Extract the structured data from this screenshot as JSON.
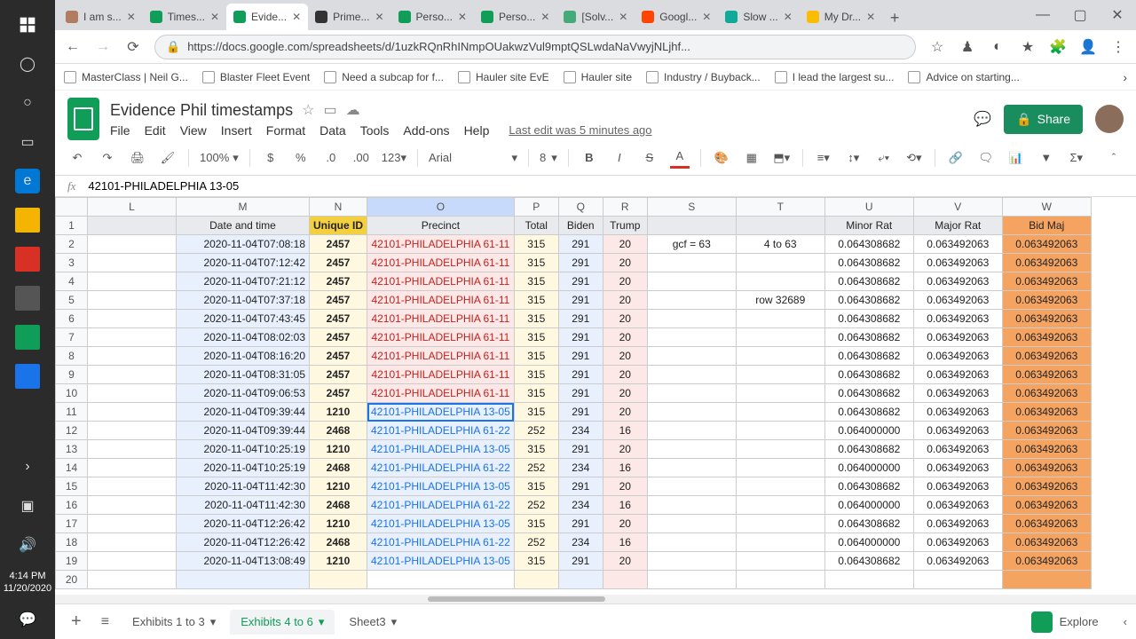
{
  "clock": {
    "time": "4:14 PM",
    "date": "11/20/2020"
  },
  "browser_tabs": [
    {
      "label": "I am s...",
      "color": "#b07d62"
    },
    {
      "label": "Times...",
      "color": "#0f9d58"
    },
    {
      "label": "Evide...",
      "color": "#0f9d58",
      "active": true
    },
    {
      "label": "Prime...",
      "color": "#333"
    },
    {
      "label": "Perso...",
      "color": "#0f9d58"
    },
    {
      "label": "Perso...",
      "color": "#0f9d58"
    },
    {
      "label": "[Solv...",
      "color": "#4a7"
    },
    {
      "label": "Googl...",
      "color": "#ff4500"
    },
    {
      "label": "Slow ...",
      "color": "#1a9"
    },
    {
      "label": "My Dr...",
      "color": "#fbbc04"
    }
  ],
  "url": "https://docs.google.com/spreadsheets/d/1uzkRQnRhINmpOUakwzVul9mptQSLwdaNaVwyjNLjhf...",
  "bookmarks": [
    "MasterClass | Neil G...",
    "Blaster Fleet Event",
    "Need a subcap for f...",
    "Hauler site EvE",
    "Hauler site",
    "Industry / Buyback...",
    "I lead the largest su...",
    "Advice on starting..."
  ],
  "doc_title": "Evidence Phil timestamps",
  "menus": [
    "File",
    "Edit",
    "View",
    "Insert",
    "Format",
    "Data",
    "Tools",
    "Add-ons",
    "Help"
  ],
  "last_edit": "Last edit was 5 minutes ago",
  "share": "Share",
  "toolbar": {
    "zoom": "100%",
    "font": "Arial",
    "fontsize": "8",
    "numfmt": "123"
  },
  "fx_value": "42101-PHILADELPHIA 13-05",
  "cols": [
    "L",
    "M",
    "N",
    "O",
    "P",
    "Q",
    "R",
    "S",
    "T",
    "U",
    "V",
    "W"
  ],
  "headers": {
    "M": "Date and time",
    "N": "Unique ID",
    "O": "Precinct",
    "P": "Total",
    "Q": "Biden",
    "R": "Trump",
    "U": "Minor Rat",
    "V": "Major Rat",
    "W": "Bid Maj"
  },
  "annot": {
    "s": "gcf = 63",
    "t": "4 to 63",
    "t4": "row 32689"
  },
  "rows": [
    {
      "r": 2,
      "m": "2020-11-04T07:08:18",
      "n": "2457",
      "o": "42101-PHILADELPHIA 61-11",
      "oc": "red",
      "p": "315",
      "q": "291",
      "rr": "20",
      "u": "0.064308682",
      "v": "0.063492063",
      "w": "0.063492063"
    },
    {
      "r": 3,
      "m": "2020-11-04T07:12:42",
      "n": "2457",
      "o": "42101-PHILADELPHIA 61-11",
      "oc": "red",
      "p": "315",
      "q": "291",
      "rr": "20",
      "u": "0.064308682",
      "v": "0.063492063",
      "w": "0.063492063"
    },
    {
      "r": 4,
      "m": "2020-11-04T07:21:12",
      "n": "2457",
      "o": "42101-PHILADELPHIA 61-11",
      "oc": "red",
      "p": "315",
      "q": "291",
      "rr": "20",
      "u": "0.064308682",
      "v": "0.063492063",
      "w": "0.063492063"
    },
    {
      "r": 5,
      "m": "2020-11-04T07:37:18",
      "n": "2457",
      "o": "42101-PHILADELPHIA 61-11",
      "oc": "red",
      "p": "315",
      "q": "291",
      "rr": "20",
      "u": "0.064308682",
      "v": "0.063492063",
      "w": "0.063492063"
    },
    {
      "r": 6,
      "m": "2020-11-04T07:43:45",
      "n": "2457",
      "o": "42101-PHILADELPHIA 61-11",
      "oc": "red",
      "p": "315",
      "q": "291",
      "rr": "20",
      "u": "0.064308682",
      "v": "0.063492063",
      "w": "0.063492063"
    },
    {
      "r": 7,
      "m": "2020-11-04T08:02:03",
      "n": "2457",
      "o": "42101-PHILADELPHIA 61-11",
      "oc": "red",
      "p": "315",
      "q": "291",
      "rr": "20",
      "u": "0.064308682",
      "v": "0.063492063",
      "w": "0.063492063"
    },
    {
      "r": 8,
      "m": "2020-11-04T08:16:20",
      "n": "2457",
      "o": "42101-PHILADELPHIA 61-11",
      "oc": "red",
      "p": "315",
      "q": "291",
      "rr": "20",
      "u": "0.064308682",
      "v": "0.063492063",
      "w": "0.063492063"
    },
    {
      "r": 9,
      "m": "2020-11-04T08:31:05",
      "n": "2457",
      "o": "42101-PHILADELPHIA 61-11",
      "oc": "red",
      "p": "315",
      "q": "291",
      "rr": "20",
      "u": "0.064308682",
      "v": "0.063492063",
      "w": "0.063492063"
    },
    {
      "r": 10,
      "m": "2020-11-04T09:06:53",
      "n": "2457",
      "o": "42101-PHILADELPHIA 61-11",
      "oc": "red",
      "p": "315",
      "q": "291",
      "rr": "20",
      "u": "0.064308682",
      "v": "0.063492063",
      "w": "0.063492063"
    },
    {
      "r": 11,
      "m": "2020-11-04T09:39:44",
      "n": "1210",
      "o": "42101-PHILADELPHIA 13-05",
      "oc": "blue",
      "p": "315",
      "q": "291",
      "rr": "20",
      "u": "0.064308682",
      "v": "0.063492063",
      "w": "0.063492063",
      "sel": true
    },
    {
      "r": 12,
      "m": "2020-11-04T09:39:44",
      "n": "2468",
      "o": "42101-PHILADELPHIA 61-22",
      "oc": "blue",
      "p": "252",
      "q": "234",
      "rr": "16",
      "u": "0.064000000",
      "v": "0.063492063",
      "w": "0.063492063"
    },
    {
      "r": 13,
      "m": "2020-11-04T10:25:19",
      "n": "1210",
      "o": "42101-PHILADELPHIA 13-05",
      "oc": "blue",
      "p": "315",
      "q": "291",
      "rr": "20",
      "u": "0.064308682",
      "v": "0.063492063",
      "w": "0.063492063"
    },
    {
      "r": 14,
      "m": "2020-11-04T10:25:19",
      "n": "2468",
      "o": "42101-PHILADELPHIA 61-22",
      "oc": "blue",
      "p": "252",
      "q": "234",
      "rr": "16",
      "u": "0.064000000",
      "v": "0.063492063",
      "w": "0.063492063"
    },
    {
      "r": 15,
      "m": "2020-11-04T11:42:30",
      "n": "1210",
      "o": "42101-PHILADELPHIA 13-05",
      "oc": "blue",
      "p": "315",
      "q": "291",
      "rr": "20",
      "u": "0.064308682",
      "v": "0.063492063",
      "w": "0.063492063"
    },
    {
      "r": 16,
      "m": "2020-11-04T11:42:30",
      "n": "2468",
      "o": "42101-PHILADELPHIA 61-22",
      "oc": "blue",
      "p": "252",
      "q": "234",
      "rr": "16",
      "u": "0.064000000",
      "v": "0.063492063",
      "w": "0.063492063"
    },
    {
      "r": 17,
      "m": "2020-11-04T12:26:42",
      "n": "1210",
      "o": "42101-PHILADELPHIA 13-05",
      "oc": "blue",
      "p": "315",
      "q": "291",
      "rr": "20",
      "u": "0.064308682",
      "v": "0.063492063",
      "w": "0.063492063"
    },
    {
      "r": 18,
      "m": "2020-11-04T12:26:42",
      "n": "2468",
      "o": "42101-PHILADELPHIA 61-22",
      "oc": "blue",
      "p": "252",
      "q": "234",
      "rr": "16",
      "u": "0.064000000",
      "v": "0.063492063",
      "w": "0.063492063"
    },
    {
      "r": 19,
      "m": "2020-11-04T13:08:49",
      "n": "1210",
      "o": "42101-PHILADELPHIA 13-05",
      "oc": "blue",
      "p": "315",
      "q": "291",
      "rr": "20",
      "u": "0.064308682",
      "v": "0.063492063",
      "w": "0.063492063"
    }
  ],
  "sheet_tabs": [
    {
      "label": "Exhibits 1 to 3"
    },
    {
      "label": "Exhibits 4 to 6",
      "active": true
    },
    {
      "label": "Sheet3"
    }
  ],
  "explore": "Explore"
}
